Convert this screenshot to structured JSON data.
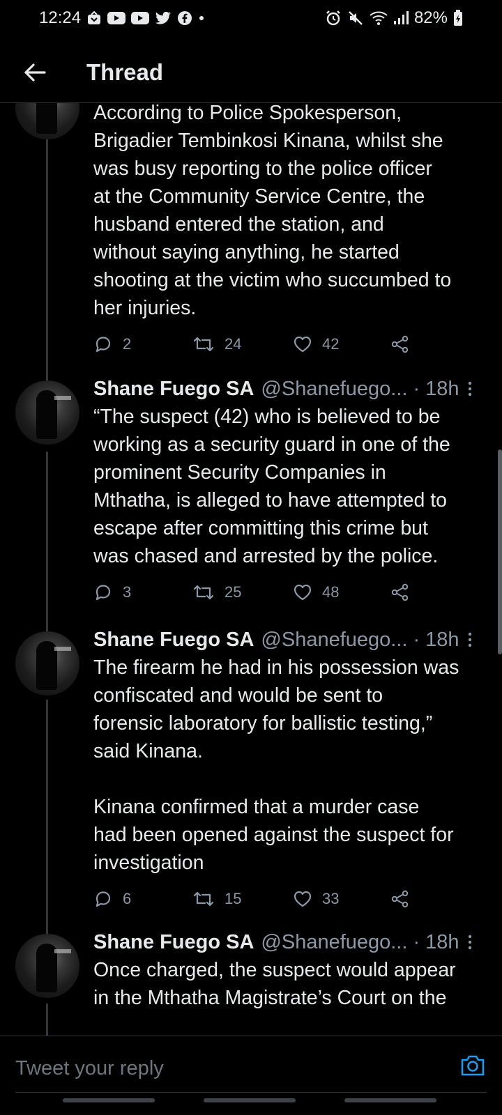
{
  "status_bar": {
    "time": "12:24",
    "battery": "82%",
    "left_icons": [
      "app-notification-icon",
      "youtube-icon",
      "youtube-icon",
      "twitter-icon",
      "facebook-icon",
      "dot-icon"
    ],
    "right_icons": [
      "alarm-icon",
      "mute-icon",
      "wifi-icon",
      "signal-icon",
      "battery-charging-icon"
    ]
  },
  "header": {
    "title": "Thread",
    "back_icon": "arrow-left-icon"
  },
  "tweets": [
    {
      "name": "",
      "handle": "",
      "time": "",
      "text": "According to Police Spokesperson,\nBrigadier Tembinkosi Kinana, whilst she\nwas busy reporting to the police officer\nat the Community Service Centre, the\nhusband entered the station, and\nwithout saying anything, he started\nshooting at the victim who succumbed to\nher injuries.",
      "replies": "2",
      "retweets": "24",
      "likes": "42"
    },
    {
      "name": "Shane Fuego SA",
      "handle": "@Shanefuego...",
      "time": "18h",
      "text": "“The suspect (42) who is believed to be\nworking as a security guard in one of the\nprominent Security Companies in\nMthatha, is alleged to have attempted to\nescape after committing this crime but\nwas chased and arrested by the police.",
      "replies": "3",
      "retweets": "25",
      "likes": "48"
    },
    {
      "name": "Shane Fuego SA",
      "handle": "@Shanefuego...",
      "time": "18h",
      "text": "The firearm he had in his possession was\nconfiscated and would be sent to\nforensic laboratory for ballistic testing,”\nsaid Kinana.\n\nKinana confirmed that a murder case\nhad been opened against the suspect for\ninvestigation",
      "replies": "6",
      "retweets": "15",
      "likes": "33"
    },
    {
      "name": "Shane Fuego SA",
      "handle": "@Shanefuego...",
      "time": "18h",
      "text": "Once charged, the suspect would appear\nin the Mthatha Magistrate’s Court on the"
    }
  ],
  "reply_bar": {
    "placeholder": "Tweet your reply",
    "camera_icon": "camera-icon"
  },
  "colors": {
    "background": "#000000",
    "text": "#e7e9ea",
    "muted": "#8b98a5",
    "accent": "#1d9bf0"
  }
}
